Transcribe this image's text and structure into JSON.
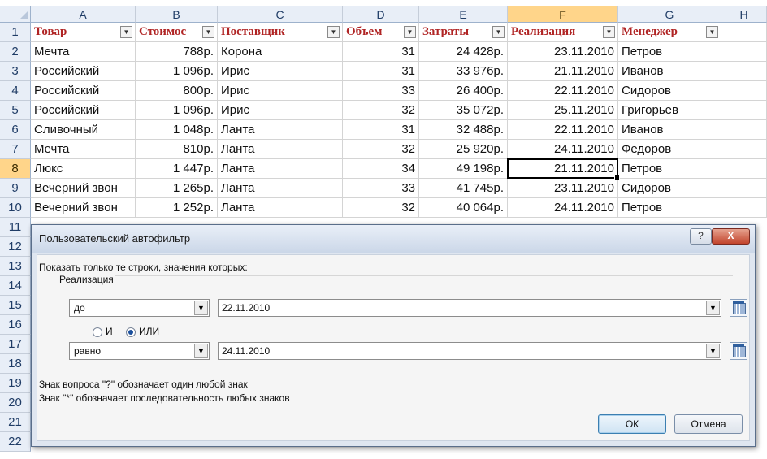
{
  "sheet": {
    "columns": [
      "A",
      "B",
      "C",
      "D",
      "E",
      "F",
      "G",
      "H"
    ],
    "rows": [
      "1",
      "2",
      "3",
      "4",
      "5",
      "6",
      "7",
      "8",
      "9",
      "10",
      "11",
      "12",
      "13",
      "14",
      "15",
      "16",
      "17",
      "18",
      "19",
      "20",
      "21",
      "22"
    ],
    "headers": [
      "Товар",
      "Стоимос",
      "Поставщик",
      "Объем",
      "Затраты",
      "Реализация",
      "Менеджер"
    ],
    "data": [
      [
        "Мечта",
        "788р.",
        "Корона",
        "31",
        "24 428р.",
        "23.11.2010",
        "Петров"
      ],
      [
        "Российский",
        "1 096р.",
        "Ирис",
        "31",
        "33 976р.",
        "21.11.2010",
        "Иванов"
      ],
      [
        "Российский",
        "800р.",
        "Ирис",
        "33",
        "26 400р.",
        "22.11.2010",
        "Сидоров"
      ],
      [
        "Российский",
        "1 096р.",
        "Ирис",
        "32",
        "35 072р.",
        "25.11.2010",
        "Григорьев"
      ],
      [
        "Сливочный",
        "1 048р.",
        "Ланта",
        "31",
        "32 488р.",
        "22.11.2010",
        "Иванов"
      ],
      [
        "Мечта",
        "810р.",
        "Ланта",
        "32",
        "25 920р.",
        "24.11.2010",
        "Федоров"
      ],
      [
        "Люкс",
        "1 447р.",
        "Ланта",
        "34",
        "49 198р.",
        "21.11.2010",
        "Петров"
      ],
      [
        "Вечерний звон",
        "1 265р.",
        "Ланта",
        "33",
        "41 745р.",
        "23.11.2010",
        "Сидоров"
      ],
      [
        "Вечерний звон",
        "1 252р.",
        "Ланта",
        "32",
        "40 064р.",
        "24.11.2010",
        "Петров"
      ]
    ],
    "selected_column": "F",
    "selected_row": "8"
  },
  "dialog": {
    "title": "Пользовательский автофильтр",
    "help": "?",
    "close": "X",
    "prompt": "Показать только те строки, значения которых:",
    "field_name": "Реализация",
    "condition1": {
      "operator": "до",
      "value": "22.11.2010"
    },
    "logic": {
      "and_label": "И",
      "or_label": "ИЛИ",
      "selected": "ИЛИ"
    },
    "condition2": {
      "operator": "равно",
      "value": "24.11.2010"
    },
    "hint1": "Знак вопроса \"?\" обозначает один любой знак",
    "hint2": "Знак \"*\" обозначает последовательность любых знаков",
    "ok": "ОК",
    "cancel": "Отмена"
  },
  "icons": {
    "filter": "dropdown-arrow-icon",
    "calendar": "calendar-icon",
    "combo": "combo-arrow-icon"
  }
}
